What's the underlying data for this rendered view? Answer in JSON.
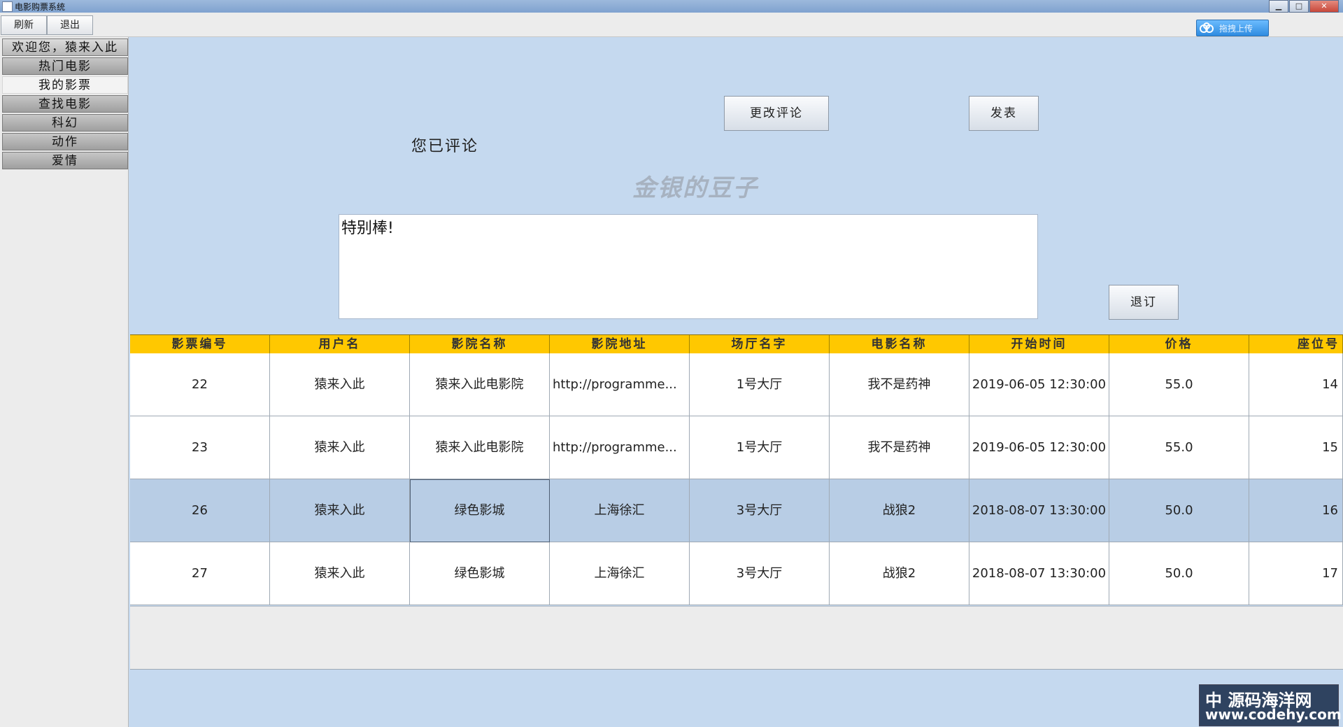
{
  "window": {
    "title": "电影购票系统"
  },
  "toolbar": {
    "refresh": "刷新",
    "exit": "退出"
  },
  "baidu_upload": {
    "label": "拖拽上传"
  },
  "sidebar": {
    "welcome": "欢迎您，猿来入此",
    "items": [
      "热门电影",
      "我的影票",
      "查找电影",
      "科幻",
      "动作",
      "爱情"
    ],
    "active": "我的影票"
  },
  "review": {
    "change_button": "更改评论",
    "publish_button": "发表",
    "status": "您已评论",
    "movie_title": "金银的豆子",
    "comment_text": "特别棒!",
    "refund_button": "退订"
  },
  "table": {
    "headers": [
      "影票编号",
      "用户名",
      "影院名称",
      "影院地址",
      "场厅名字",
      "电影名称",
      "开始时间",
      "价格",
      "座位号"
    ],
    "rows": [
      [
        "22",
        "猿来入此",
        "猿来入此电影院",
        "http://programme...",
        "1号大厅",
        "我不是药神",
        "2019-06-05 12:30:00",
        "55.0",
        "14"
      ],
      [
        "23",
        "猿来入此",
        "猿来入此电影院",
        "http://programme...",
        "1号大厅",
        "我不是药神",
        "2019-06-05 12:30:00",
        "55.0",
        "15"
      ],
      [
        "26",
        "猿来入此",
        "绿色影城",
        "上海徐汇",
        "3号大厅",
        "战狼2",
        "2018-08-07 13:30:00",
        "50.0",
        "16"
      ],
      [
        "27",
        "猿来入此",
        "绿色影城",
        "上海徐汇",
        "3号大厅",
        "战狼2",
        "2018-08-07 13:30:00",
        "50.0",
        "17"
      ]
    ],
    "selected_row": 2
  },
  "watermark": {
    "line1": "中 源码海洋网",
    "line2": "www.codehy.com"
  },
  "colors": {
    "header": "#ffc800",
    "panel": "#c5d9ef",
    "selected_row": "#b8cde5"
  }
}
